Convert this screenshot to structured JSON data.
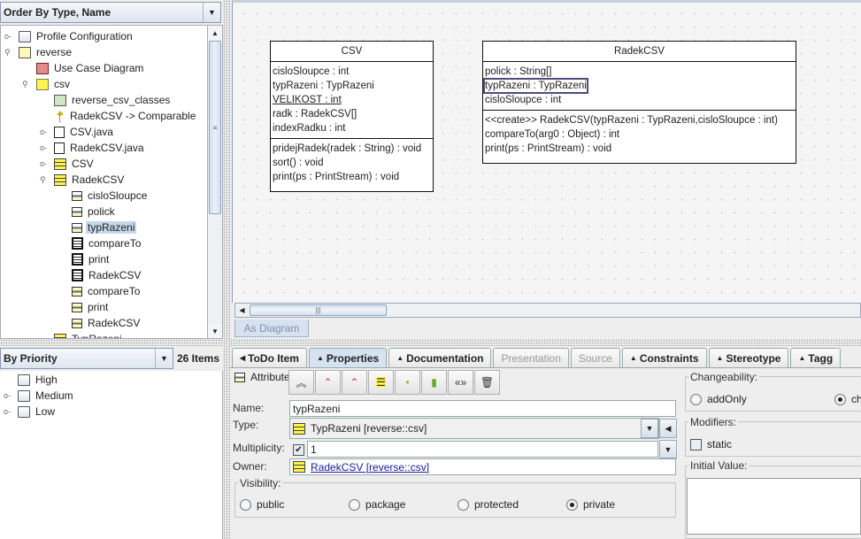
{
  "explorer": {
    "order_combo": "Order By Type, Name",
    "items": [
      {
        "label": "Profile Configuration",
        "icon": "folder-icon",
        "level": 0,
        "handle": "collapsed"
      },
      {
        "label": "reverse",
        "icon": "package-icon",
        "level": 0,
        "handle": "expanded"
      },
      {
        "label": "Use Case Diagram",
        "icon": "usecase-diagram-icon",
        "level": 1,
        "handle": "none"
      },
      {
        "label": "csv",
        "icon": "package-icon",
        "level": 1,
        "handle": "expanded"
      },
      {
        "label": "reverse_csv_classes",
        "icon": "class-diagram-icon",
        "level": 2,
        "handle": "none"
      },
      {
        "label": "RadekCSV -> Comparable",
        "icon": "generalization-icon",
        "level": 2,
        "handle": "none"
      },
      {
        "label": "CSV.java",
        "icon": "component-icon",
        "level": 2,
        "handle": "collapsed"
      },
      {
        "label": "RadekCSV.java",
        "icon": "component-icon",
        "level": 2,
        "handle": "collapsed"
      },
      {
        "label": "CSV",
        "icon": "class-icon",
        "level": 2,
        "handle": "collapsed"
      },
      {
        "label": "RadekCSV",
        "icon": "class-icon",
        "level": 2,
        "handle": "expanded"
      },
      {
        "label": "cisloSloupce",
        "icon": "attribute-icon",
        "level": 3,
        "handle": "none"
      },
      {
        "label": "polick",
        "icon": "attribute-icon",
        "level": 3,
        "handle": "none"
      },
      {
        "label": "typRazeni",
        "icon": "attribute-icon",
        "level": 3,
        "handle": "none",
        "selected": true
      },
      {
        "label": "compareTo",
        "icon": "operation-icon",
        "level": 3,
        "handle": "none"
      },
      {
        "label": "print",
        "icon": "operation-icon",
        "level": 3,
        "handle": "none"
      },
      {
        "label": "RadekCSV",
        "icon": "operation-icon",
        "level": 3,
        "handle": "none"
      },
      {
        "label": "compareTo",
        "icon": "method-icon",
        "level": 3,
        "handle": "none"
      },
      {
        "label": "print",
        "icon": "method-icon",
        "level": 3,
        "handle": "none"
      },
      {
        "label": "RadekCSV",
        "icon": "method-icon",
        "level": 3,
        "handle": "none"
      },
      {
        "label": "TypRazeni",
        "icon": "class-icon",
        "level": 2,
        "handle": "none"
      }
    ]
  },
  "todo": {
    "priority_combo": "By Priority",
    "count": "26 Items",
    "items": [
      {
        "label": "High",
        "handle": "none"
      },
      {
        "label": "Medium",
        "handle": "collapsed"
      },
      {
        "label": "Low",
        "handle": "collapsed"
      }
    ]
  },
  "diagram": {
    "tab": "As Diagram",
    "classes": [
      {
        "name": "CSV",
        "attributes": [
          {
            "text": "cisloSloupce : int"
          },
          {
            "text": "typRazeni : TypRazeni"
          },
          {
            "text": "VELIKOST : int",
            "static": true
          },
          {
            "text": "radk : RadekCSV[]"
          },
          {
            "text": "indexRadku : int"
          }
        ],
        "operations": [
          "pridejRadek(radek : String) : void",
          "sort() : void",
          "print(ps : PrintStream) : void"
        ]
      },
      {
        "name": "RadekCSV",
        "attributes": [
          {
            "text": "polick : String[]"
          },
          {
            "text": "typRazeni : TypRazeni",
            "selected": true
          },
          {
            "text": "cisloSloupce : int"
          }
        ],
        "operations": [
          "<<create>> RadekCSV(typRazeni : TypRazeni,cisloSloupce : int)",
          "compareTo(arg0 : Object) : int",
          "print(ps : PrintStream) : void"
        ]
      }
    ]
  },
  "details": {
    "tabs": [
      {
        "label": "ToDo Item",
        "arrow": "◀",
        "state": "normal"
      },
      {
        "label": "Properties",
        "arrow": "▲",
        "state": "active"
      },
      {
        "label": "Documentation",
        "arrow": "▲",
        "state": "normal"
      },
      {
        "label": "Presentation",
        "arrow": "",
        "state": "disabled"
      },
      {
        "label": "Source",
        "arrow": "",
        "state": "disabled"
      },
      {
        "label": "Constraints",
        "arrow": "▲",
        "state": "normal"
      },
      {
        "label": "Stereotype",
        "arrow": "▲",
        "state": "normal"
      },
      {
        "label": "Tagg",
        "arrow": "▲",
        "state": "normal"
      }
    ],
    "element_kind": "Attribute",
    "toolbar": [
      {
        "name": "go-up-icon",
        "glyph": "︽"
      },
      {
        "name": "navigate-back-icon",
        "glyph": "⌃"
      },
      {
        "name": "navigate-forward-icon",
        "glyph": "⌃"
      },
      {
        "name": "new-attribute-icon",
        "glyph": "☰"
      },
      {
        "name": "new-enumeration-literal-icon",
        "glyph": "•"
      },
      {
        "name": "new-datatype-icon",
        "glyph": "▮"
      },
      {
        "name": "new-stereotype-icon",
        "glyph": "«»"
      },
      {
        "name": "delete-icon",
        "glyph": "🗑"
      }
    ],
    "labels": {
      "name": "Name:",
      "type": "Type:",
      "multiplicity": "Multiplicity:",
      "owner": "Owner:",
      "visibility": "Visibility:",
      "changeability": "Changeability:",
      "modifiers": "Modifiers:",
      "initial_value": "Initial Value:"
    },
    "name_value": "typRazeni",
    "type_value": "TypRazeni [reverse::csv]",
    "multiplicity_checked": true,
    "multiplicity_value": "1",
    "owner_value": "RadekCSV [reverse::csv]",
    "visibility_options": [
      {
        "label": "public",
        "selected": false
      },
      {
        "label": "package",
        "selected": false
      },
      {
        "label": "protected",
        "selected": false
      },
      {
        "label": "private",
        "selected": true
      }
    ],
    "changeability_options": [
      {
        "label": "addOnly",
        "selected": false
      },
      {
        "label": "ch",
        "selected": true
      }
    ],
    "static_label": "static",
    "static_checked": false,
    "initial_value": ""
  }
}
